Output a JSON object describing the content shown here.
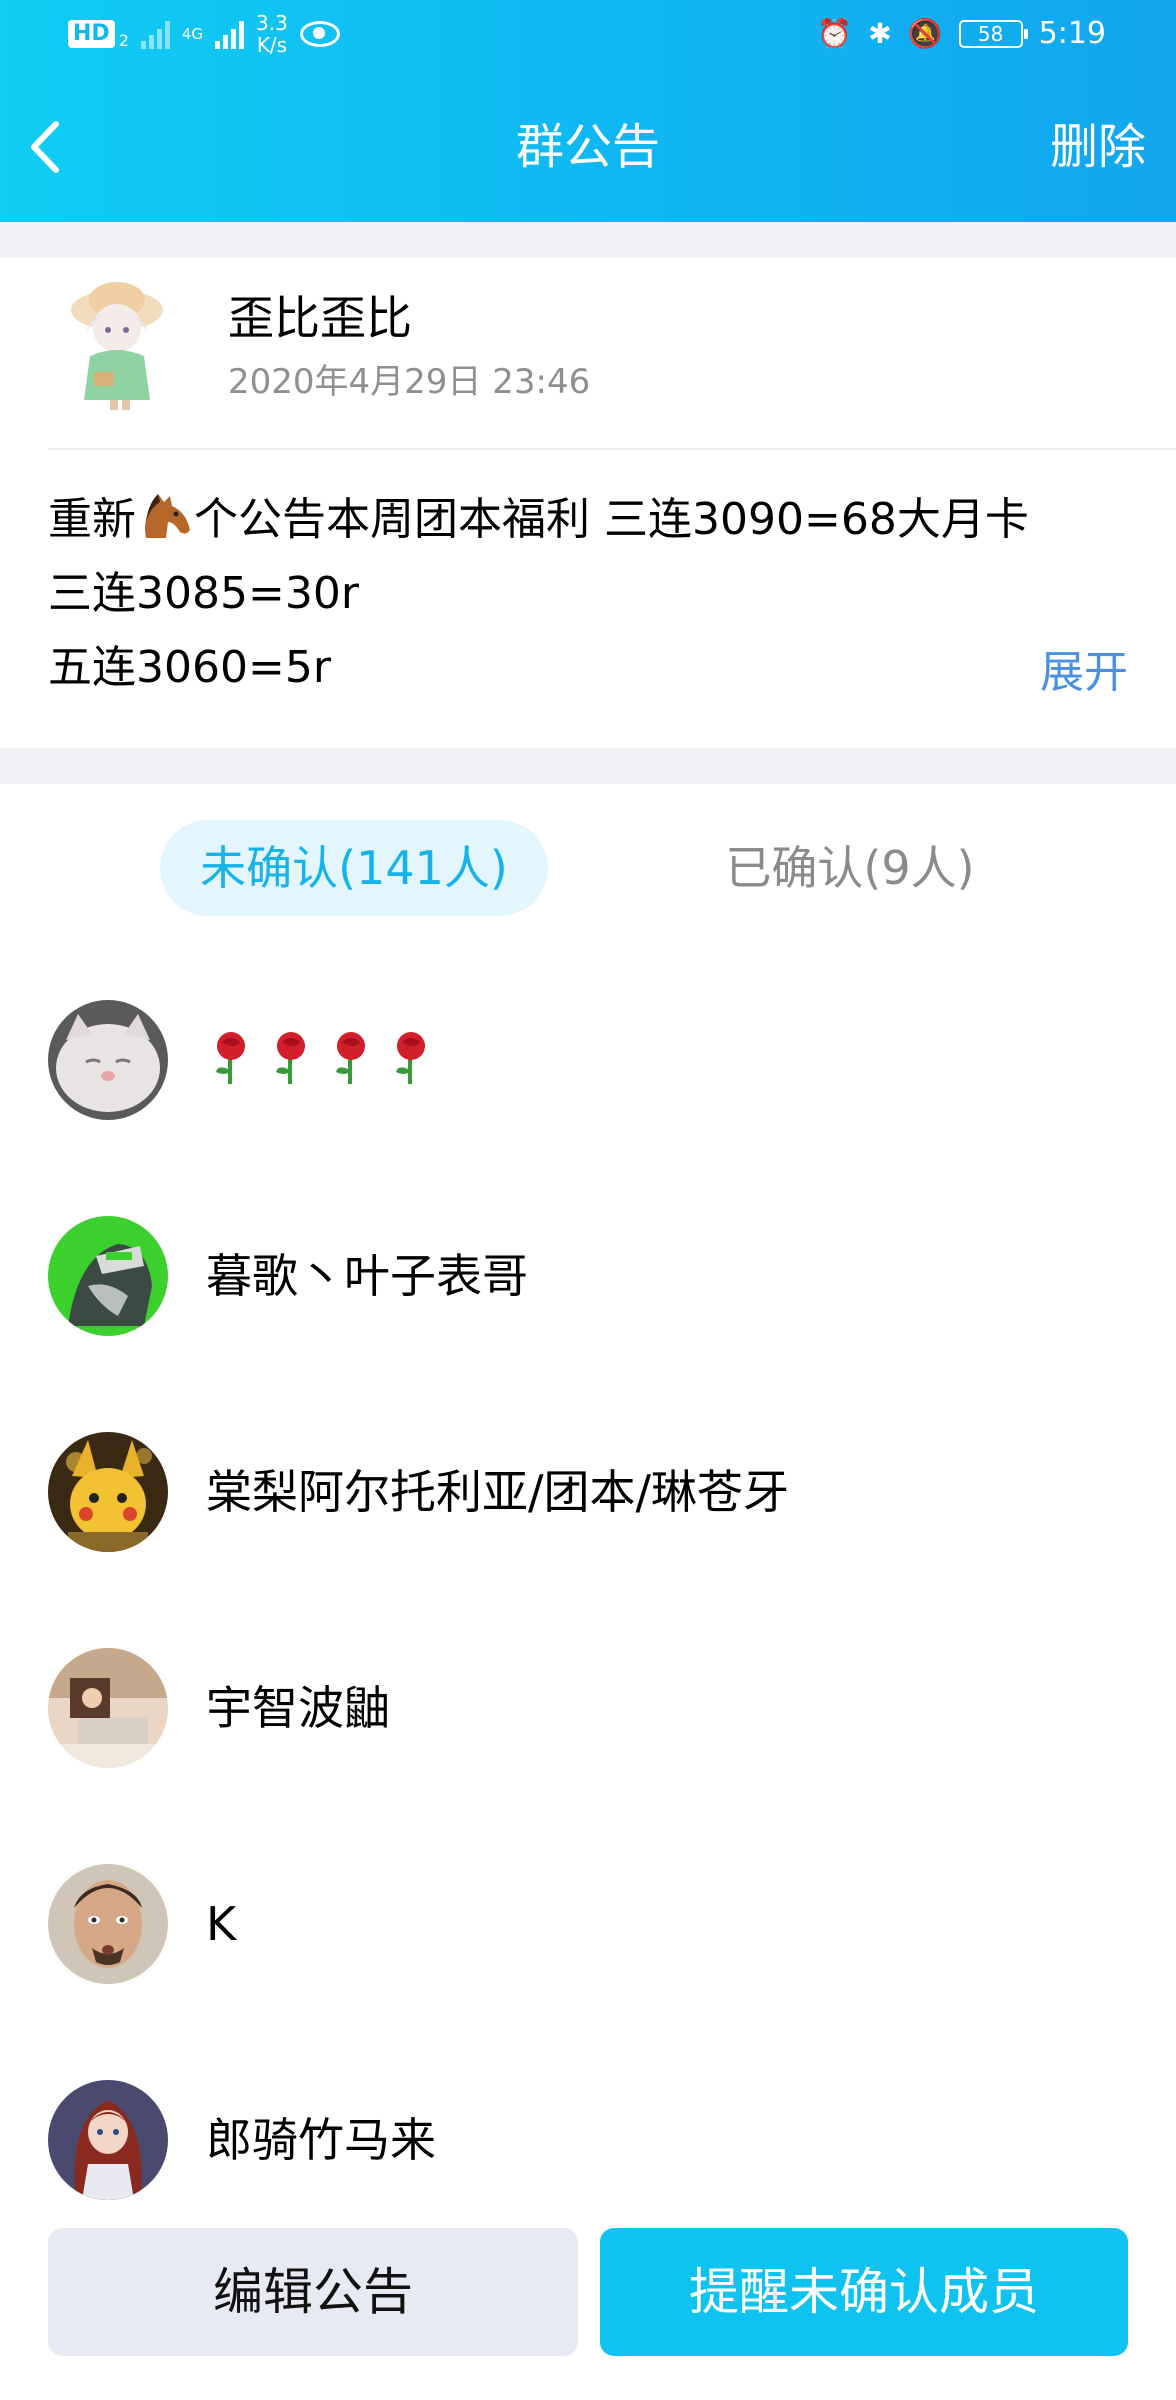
{
  "statusbar": {
    "hd_badge": "HD",
    "hd_sim": "2",
    "net_type": "4G",
    "speed_value": "3.3",
    "speed_unit": "K/s",
    "battery": "58",
    "time": "5:19",
    "icons": [
      "signal-x-icon",
      "signal-4g-icon",
      "eye-icon",
      "alarm-icon",
      "bluetooth-icon",
      "vibrate-icon",
      "mute-icon",
      "battery-icon"
    ]
  },
  "nav": {
    "title": "群公告",
    "action": "删除"
  },
  "notice": {
    "poster_name": "歪比歪比",
    "post_time": "2020年4月29日 23:46",
    "line1_before": "重新",
    "line1_after": "个公告本周团本福利 三连3090=68大月卡",
    "line2": "三连3085=30r",
    "line3": "五连3060=5r",
    "expand_label": "展开"
  },
  "tabs": {
    "unconfirmed": "未确认(141人)",
    "confirmed": "已确认(9人)"
  },
  "members": [
    {
      "name": "",
      "roses": 4
    },
    {
      "name": "暮歌丶叶子表哥"
    },
    {
      "name": "棠梨阿尔托利亚/团本/琳苍牙"
    },
    {
      "name": "宇智波鼬"
    },
    {
      "name": "K"
    },
    {
      "name": "郎骑竹马来"
    }
  ],
  "buttons": {
    "edit": "编辑公告",
    "remind": "提醒未确认成员"
  },
  "colors": {
    "header_start": "#10cdf3",
    "header_end": "#12a6ef",
    "accent": "#0ec3f0",
    "tab_active_bg": "#e3f6fd",
    "tab_active_text": "#15b3ea",
    "link": "#4a90e2",
    "edit_button_bg": "#e7eaf2"
  }
}
